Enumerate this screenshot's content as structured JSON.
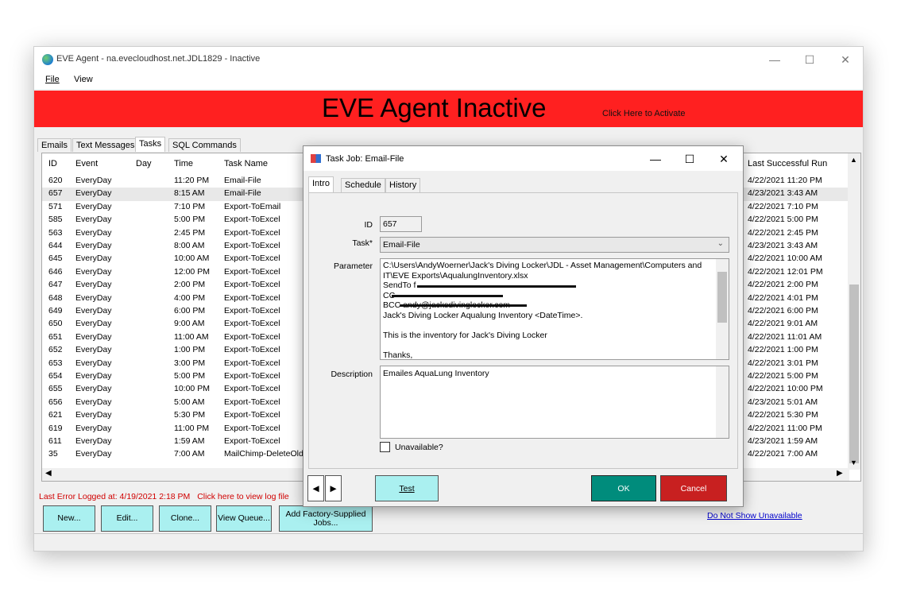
{
  "window": {
    "title": "EVE Agent - na.evecloudhost.net.JDL1829 - Inactive"
  },
  "menu": [
    "File",
    "View"
  ],
  "banner": {
    "title": "EVE Agent Inactive",
    "link": "Click Here to Activate",
    "color": "#ff2020"
  },
  "tabs": [
    "Emails",
    "Text Messages",
    "Tasks",
    "SQL Commands"
  ],
  "active_tab": "Tasks",
  "table": {
    "columns": [
      "ID",
      "Event",
      "Day",
      "Time",
      "Task Name",
      "Last Successful Run"
    ],
    "rows": [
      {
        "id": "620",
        "event": "EveryDay",
        "day": "",
        "time": "11:20 PM",
        "name": "Email-File",
        "last": "4/22/2021 11:20 PM"
      },
      {
        "id": "657",
        "event": "EveryDay",
        "day": "",
        "time": "8:15 AM",
        "name": "Email-File",
        "last": "4/23/2021 3:43 AM"
      },
      {
        "id": "571",
        "event": "EveryDay",
        "day": "",
        "time": "7:10 PM",
        "name": "Export-ToEmail",
        "last": "4/22/2021 7:10 PM"
      },
      {
        "id": "585",
        "event": "EveryDay",
        "day": "",
        "time": "5:00 PM",
        "name": "Export-ToExcel",
        "last": "4/22/2021 5:00 PM"
      },
      {
        "id": "563",
        "event": "EveryDay",
        "day": "",
        "time": "2:45 PM",
        "name": "Export-ToExcel",
        "last": "4/22/2021 2:45 PM"
      },
      {
        "id": "644",
        "event": "EveryDay",
        "day": "",
        "time": "8:00 AM",
        "name": "Export-ToExcel",
        "last": "4/23/2021 3:43 AM"
      },
      {
        "id": "645",
        "event": "EveryDay",
        "day": "",
        "time": "10:00 AM",
        "name": "Export-ToExcel",
        "last": "4/22/2021 10:00 AM"
      },
      {
        "id": "646",
        "event": "EveryDay",
        "day": "",
        "time": "12:00 PM",
        "name": "Export-ToExcel",
        "last": "4/22/2021 12:01 PM"
      },
      {
        "id": "647",
        "event": "EveryDay",
        "day": "",
        "time": "2:00 PM",
        "name": "Export-ToExcel",
        "last": "4/22/2021 2:00 PM"
      },
      {
        "id": "648",
        "event": "EveryDay",
        "day": "",
        "time": "4:00 PM",
        "name": "Export-ToExcel",
        "last": "4/22/2021 4:01 PM"
      },
      {
        "id": "649",
        "event": "EveryDay",
        "day": "",
        "time": "6:00 PM",
        "name": "Export-ToExcel",
        "last": "4/22/2021 6:00 PM"
      },
      {
        "id": "650",
        "event": "EveryDay",
        "day": "",
        "time": "9:00 AM",
        "name": "Export-ToExcel",
        "last": "4/22/2021 9:01 AM"
      },
      {
        "id": "651",
        "event": "EveryDay",
        "day": "",
        "time": "11:00 AM",
        "name": "Export-ToExcel",
        "last": "4/22/2021 11:01 AM"
      },
      {
        "id": "652",
        "event": "EveryDay",
        "day": "",
        "time": "1:00 PM",
        "name": "Export-ToExcel",
        "last": "4/22/2021 1:00 PM"
      },
      {
        "id": "653",
        "event": "EveryDay",
        "day": "",
        "time": "3:00 PM",
        "name": "Export-ToExcel",
        "last": "4/22/2021 3:01 PM"
      },
      {
        "id": "654",
        "event": "EveryDay",
        "day": "",
        "time": "5:00 PM",
        "name": "Export-ToExcel",
        "last": "4/22/2021 5:00 PM"
      },
      {
        "id": "655",
        "event": "EveryDay",
        "day": "",
        "time": "10:00 PM",
        "name": "Export-ToExcel",
        "last": "4/22/2021 10:00 PM"
      },
      {
        "id": "656",
        "event": "EveryDay",
        "day": "",
        "time": "5:00 AM",
        "name": "Export-ToExcel",
        "last": "4/23/2021 5:01 AM"
      },
      {
        "id": "621",
        "event": "EveryDay",
        "day": "",
        "time": "5:30 PM",
        "name": "Export-ToExcel",
        "last": "4/22/2021 5:30 PM"
      },
      {
        "id": "619",
        "event": "EveryDay",
        "day": "",
        "time": "11:00 PM",
        "name": "Export-ToExcel",
        "last": "4/22/2021 11:00 PM"
      },
      {
        "id": "611",
        "event": "EveryDay",
        "day": "",
        "time": "1:59 AM",
        "name": "Export-ToExcel",
        "last": "4/23/2021 1:59 AM"
      },
      {
        "id": "35",
        "event": "EveryDay",
        "day": "",
        "time": "7:00 AM",
        "name": "MailChimp-DeleteOldC",
        "last": "4/22/2021 7:00 AM"
      }
    ],
    "selected_row": 1
  },
  "error": {
    "text": "Last Error Logged at: 4/19/2021 2:18 PM",
    "link": "Click here to view log file"
  },
  "buttons": {
    "new": "New...",
    "edit": "Edit...",
    "clone": "Clone...",
    "queue": "View Queue...",
    "factory": "Add Factory-Supplied Jobs...",
    "hide": "Do Not Show Unavailable"
  },
  "dialog": {
    "title": "Task Job: Email-File",
    "tabs": [
      "Intro",
      "Schedule",
      "History"
    ],
    "id_label": "ID",
    "id_value": "657",
    "task_label": "Task*",
    "task_value": "Email-File",
    "param_label": "Parameter",
    "param_lines": [
      "C:\\Users\\AndyWoerner\\Jack's Diving Locker\\JDL - Asset Management\\Computers and",
      "IT\\EVE Exports\\AqualungInventory.xlsx",
      "SendTo f",
      "CC",
      "BCC andy@jacksdivinglocker.com",
      "Jack's Diving Locker Aqualung Inventory <DateTime>.",
      "",
      "This is the inventory for Jack's Diving Locker",
      "",
      "Thanks,"
    ],
    "desc_label": "Description",
    "desc_value": "Emailes AquaLung Inventory",
    "unavailable_label": "Unavailable?",
    "test": "Test",
    "ok": "OK",
    "cancel": "Cancel"
  }
}
